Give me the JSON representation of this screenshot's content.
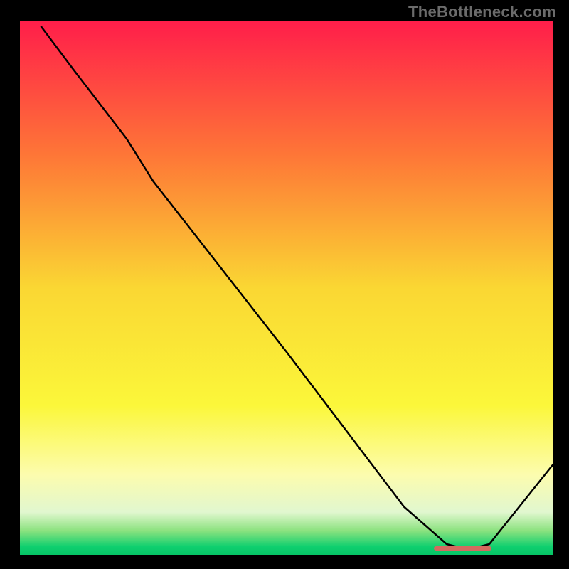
{
  "watermark": "TheBottleneck.com",
  "chart_data": {
    "type": "line",
    "title": "",
    "xlabel": "",
    "ylabel": "",
    "xlim": [
      0,
      100
    ],
    "ylim": [
      0,
      100
    ],
    "grid": false,
    "legend": null,
    "series": [
      {
        "name": "bottleneck-curve",
        "x": [
          4,
          10,
          20,
          25,
          50,
          72,
          80,
          84,
          88,
          100
        ],
        "values": [
          99,
          91,
          78,
          70,
          38,
          9,
          2,
          1,
          2,
          17
        ]
      }
    ],
    "marker_segment": {
      "name": "optimal-range-marker",
      "x_start": 78,
      "x_end": 88,
      "y": 1.2,
      "color": "#d46a5f"
    },
    "background_gradient": {
      "stops": [
        {
          "offset": 0.0,
          "color": "#ff1e4a"
        },
        {
          "offset": 0.25,
          "color": "#fe7637"
        },
        {
          "offset": 0.5,
          "color": "#fad733"
        },
        {
          "offset": 0.72,
          "color": "#fbf73a"
        },
        {
          "offset": 0.85,
          "color": "#fcfcae"
        },
        {
          "offset": 0.92,
          "color": "#e1f7cf"
        },
        {
          "offset": 0.955,
          "color": "#8be27f"
        },
        {
          "offset": 0.985,
          "color": "#0fcf6f"
        },
        {
          "offset": 1.0,
          "color": "#06c566"
        }
      ]
    }
  }
}
